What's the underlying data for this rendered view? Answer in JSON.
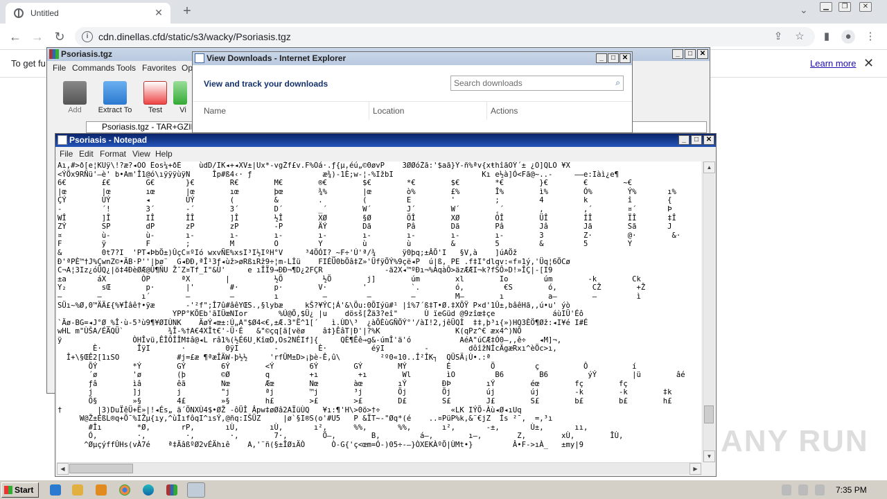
{
  "browser": {
    "tab_title": "Untitled",
    "url": "cdn.dinellas.cfd/static/s3/wacky/Psoriasis.tgz",
    "infobar_text": "To get fu",
    "learn_more": "Learn more"
  },
  "winrar": {
    "title": "Psoriasis.tgz",
    "menu": [
      "File",
      "Commands",
      "Tools",
      "Favorites",
      "Op"
    ],
    "toolbar": [
      "Add",
      "Extract To",
      "Test",
      "Vi"
    ],
    "path_text": "Psoriasis.tgz - TAR+GZIP a"
  },
  "ie_downloads": {
    "title": "View Downloads - Internet Explorer",
    "heading": "View and track your downloads",
    "search_placeholder": "Search downloads",
    "columns": [
      "Name",
      "Location",
      "Actions"
    ]
  },
  "notepad": {
    "title": "Psoriasis - Notepad",
    "menu": [
      "File",
      "Edit",
      "Format",
      "View",
      "Help"
    ],
    "content": [
      "Aı,#>ð[e¦KUÿ\\!?æ?◂ÕÖ Êos¼+ðÈ    ùdD/ÏK◂+◂XV±|Ux*-vgŽf£v.F%Öá·.ƒ{µ,éú„©0øvP    3ØØóŽã:'$aã}Ý-ñ%ªv{xŧhîãOÝ´± ¿Ö]QLÓ ¥X",
      "<ÝÖx9RÑü'—è' b•Am'Î1@ó\\ıÿÿÿùÿN     Îp#ß4‹· ƒ                æ¾)-1È;w-¦-%IžbI                    Kı e½à]Ó<Fã@~..-     ——e:Iàì¿e¶",
      "6€        £€        G€       }€        R€        M€        ®€        $€        *€        $€        *€        }€        €        ~€",
      "|œ        |œ        ıœ       |œ        ıœ        þœ        ¾%        |œ        ò%        £%        Î%        ì%        Ó%        Ý%       ı%",
      "ÇÝ        ÙÝ        ◂        ÙÝ        (         &         .         (         E         '         ;         4         k         î        {",
      "-         ´!        3´       -´        3´        D´        _´        W´        J´        W´        ¸´        ,         ,´        ¤´       Þ",
      "WÎ        ]Î        IÎ       ÎÎ        ]Î        ½Î        XØ        §Ø        ÖÎ        XØ        ÓÎ        ÜÎ        ÍÎ        ÏÎ       ‡Î",
      "ZÝ        SP        dP       zP        zP        -P        ÄÝ        Dã        Pâ        Dã        Pâ        Jâ        Jã        Sã       J",
      "¤         ù-        ù-       ı-        ı-        ı-        ı-        ı-        ı-        ı-        ı-        3         Z·        @·        &·",
      "F         ÿ         F        ;         M         O         Y         ù         ù         &         5         &         5         Y",
      "&         0t7?I  'PT◂ÞbÖ±)ÛçC¤ºIó wxvÑE%xsI³I½IºH°V     ³4ÖÓI?_~F÷'Ú'ª/¾      ÿ0þq;±ÂÕ'I   §V,à    ]úAÖž",
      "Ð'ªPÈ™†J%ÇwnZ©•ÄB·P''|þø¨  G◂ÐÐ,ªÎ¹3ƒ◂ùž>øRßıRž9÷¦m-Lİü    FIÉÜ0bÖâ‡Z»'ÜfÿÖÝ%9çë◂P  ú|ß, PE .f‡I°dlqv:«f¤1ý,'Üq¦6ÖCø",
      "C¬A¦3Iz¿óÜQ¿|ö‡4ÐèØÆ@Û¶ÑU Ž¯Z¤Tf_I\"&Ù'     e ıÎÏ9→ÐÐ¬¶D¿2FÇR              -ä2X◂™ºÐı¬%ÁqàÔ>äzÆÆI¬k?fŠÔ»D!»ÎÇ|-[I9",
      "±a       áX        ÒP       ªX        |          ½Ö         ½Ö        j]        úm        xl        Io        úm        -k        Ck",
      "Y₂        sŒ        p·       |'        #·        p·        V·        '          `.        ó,         €S        ó,        CŽ        +Ž",
      "—        —         ı´        —         —         ı          —         —         —         M—        ı          a—        —         ì",
      "SÜı~%Ø,0™ÄÄ£{%¥Îâê†•ÿæ       -'²f\";Î7û#âêYŒS.,§lybæ     kŠ?¥ÝC¦Á'&\\Öu:0ÕIýü#¹ |î%7´ß‡T•Ø.‡XÕŸ P×d'1Û±,bâêHã,,ú•u' ýò",
      "                          YPP°KÕEb'ãIÜœNIor       %Ú@Õ,$Ü¿ |u    dösš[Žä3?eî\"      Ù ïeGüd @9zîœ‡çe             áùIÜ'Éô",
      "`Äø-BG=◂J°Ø_%Î·ù-5³ù9¶¥ØIÙNK    ÄøÝ◂œ±:Ú„A\"$Ø4<€,±Æ.3\"Ë^1[´   ì.ÙD\\³  ¿àÖÈùGÑÖÝ°'/àI!2,jêÜQÌ  ‡‡,þ³ı{»)HQ3ÈÖ¶Øž:◂I¥é I#É",
      "wHL m\"ÙŠA/ÉÄQÜ`          ¾Î-%†A€4XÎt€'-Ü·É   &\"©çq[ä[vëø    â‡}ÊâT|Ð'|?%K                 K(qPz^€ æx4^)NÕ",
      "ÿ                ÒHÎvü,ÊÎÔÎÎM‡â@◂L râ1%(½É6U¸KîœD,Os2NÉIf]{     QÈ¶Êê→g&-úmÎ'ä'ó           AéA\"úCÆ‡Ó0—,,ê÷   ◂M]¬,",
      "        È·        ÎÿI       ·         0ÿI        -         È·          éÿI         -         dôîžNÍcÄgæRxı^èÖc>ı,",
      "  Î+\\§ŒÊ2[1ıSO             #j=£æ ¶ªæÎÄW-þ½½     'rfÜM±D>¡þè-Ê,û\\         ²º0«10..Î²ÎK┐  QÜSÄ¡Ù•.:ª",
      "       ÕÝ        *Ý        GÝ        6Ý        <Ý        6Ý        GÝ        MÝ         É         Ö         ç          Ô          í",
      "       ´ø        'ø        (þ        ©Ø        q         +ı         +ı        Wl        ìO         B6        B6         ýÝ        |ü        âé",
      "       ƒâ        ìâ        êã        Nœ        Æœ        Nœ        àœ        ıÝ        ÐÞ        ıÝ        éœ        fç        fç",
      "       j         ]j        j         \"j        ªj        ™j        ³j        Öj        Öj        új        új        -k        -k        ‡k        ıIk",
      "       Ö§        »§        4£        »§        h£        >£        >£        D£        S£        J£        S£        b£        b£        h£",
      "†        |3)DuÏêÜ+Ë»|!◂És„ ä´ÖNXÙ4$•ØŽ -ôÜÎ Âpw‡øØâ2AÏüÙQ   ¥ı:¶'H\\>0ö>†÷                «LK IÝÖ-Àù◂Ø◂ıUq",
      "     W@Ž±ÉßL®q+Ö¯%IŽµ{ıy,^ùÌıfôqI^ısÝ,@ñq:IŠÜZ     |ø`§I®S(o'#U5   P &ÏT~-\"Øq*(é    ..¤PüP%k‚&¨€jZ  Ís ²¯,  =,³ı",
      "       #Îı        *Ø,       rP,       ıÙ,       ıÙ,       ı²,      %%,       %%,       ı²,       -±,       Ù±,       ıı,",
      "       Ó,         ·,         ·,        ·,        7·,        Ö—,        B,         á—,        ı—,        Z,        xÙ,        ÎÙ,",
      "      ^ØµçýffÛHs(vÀ7é    ª‡ÄâßºØ2vÉÄhıê    A,'¨ñ(§±ÎØıÄÒ      Ò-G{'ç<œm=Ó-)05÷-—}ÒXEKÀºÕ|ÙMt•}         Â•F->ıÀ_   ±my|9"
    ]
  },
  "taskbar": {
    "start_label": "Start",
    "clock": "7:35 PM"
  },
  "watermark": "ANY RUN"
}
